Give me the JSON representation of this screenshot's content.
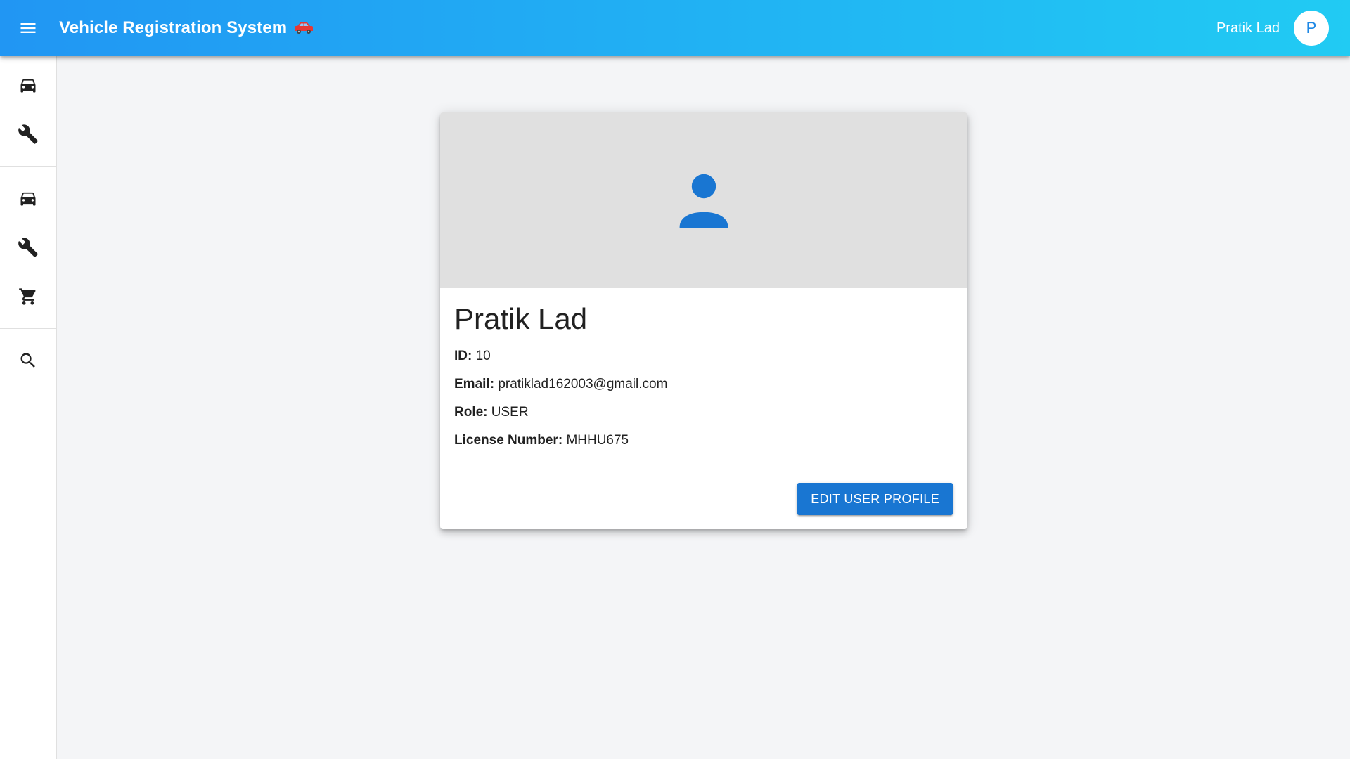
{
  "app": {
    "title": "Vehicle Registration System",
    "title_emoji_icon": "red-car-icon",
    "user_name": "Pratik Lad",
    "avatar_letter": "P",
    "colors": {
      "appbar_gradient_start": "#2196f3",
      "appbar_gradient_end": "#21cbf3",
      "primary": "#1976d2",
      "avatar_text": "#1e88e5"
    }
  },
  "sidebar": {
    "groups": [
      [
        {
          "icon": "car-icon"
        },
        {
          "icon": "wrench-icon"
        }
      ],
      [
        {
          "icon": "car-icon"
        },
        {
          "icon": "wrench-icon"
        },
        {
          "icon": "cart-icon"
        }
      ],
      [
        {
          "icon": "search-icon"
        }
      ]
    ]
  },
  "profile": {
    "avatar_icon": "person-icon",
    "name": "Pratik Lad",
    "fields": [
      {
        "label": "ID:",
        "value": "10"
      },
      {
        "label": "Email:",
        "value": "pratiklad162003@gmail.com"
      },
      {
        "label": "Role:",
        "value": "USER"
      },
      {
        "label": "License Number:",
        "value": "MHHU675"
      }
    ],
    "edit_button_label": "EDIT USER PROFILE"
  }
}
